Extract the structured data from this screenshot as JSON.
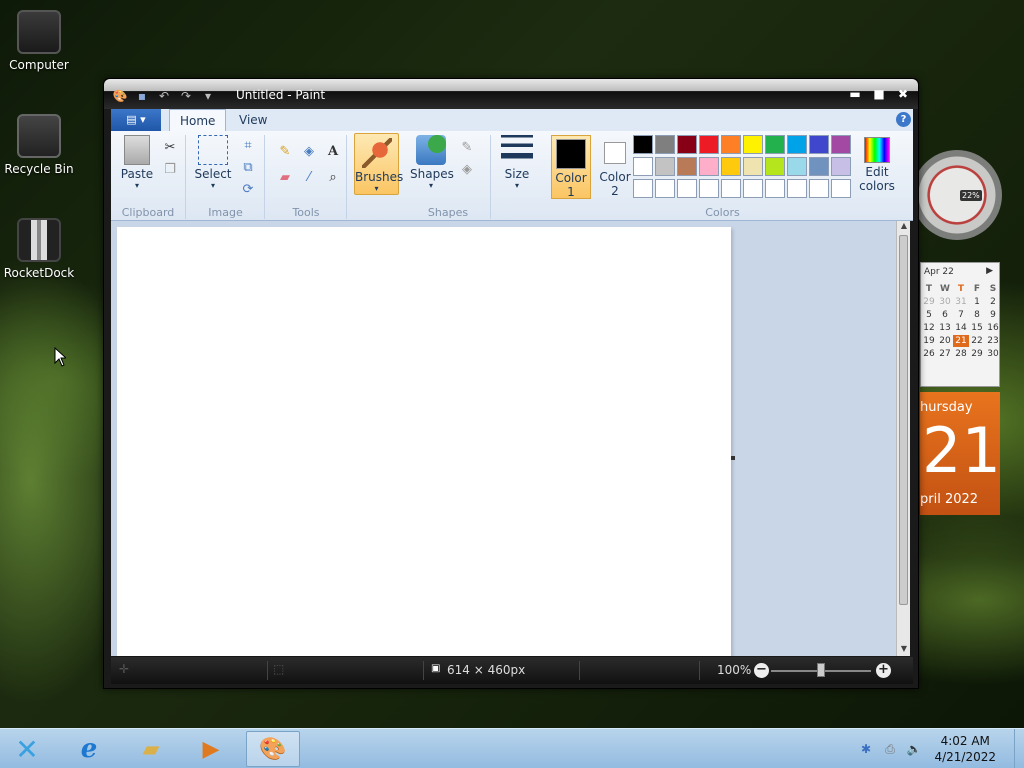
{
  "desktop": {
    "icons": [
      {
        "label": "Computer"
      },
      {
        "label": "Recycle Bin"
      },
      {
        "label": "RocketDock"
      }
    ]
  },
  "window": {
    "title": "Untitled - Paint",
    "quick_access": [
      "save-icon",
      "undo-icon",
      "redo-icon",
      "customize-icon"
    ],
    "controls": {
      "minimize": "▬",
      "maximize": "■",
      "close": "✖"
    }
  },
  "ribbon": {
    "file_menu": "▤ ▾",
    "tabs": [
      {
        "label": "Home",
        "active": true
      },
      {
        "label": "View",
        "active": false
      }
    ],
    "help": "?",
    "groups": {
      "clipboard": {
        "label": "Clipboard",
        "paste": "Paste"
      },
      "image": {
        "label": "Image",
        "select": "Select"
      },
      "tools": {
        "label": "Tools"
      },
      "brushes": {
        "label": "Brushes"
      },
      "shapes": {
        "label": "Shapes",
        "shapes": "Shapes"
      },
      "size": {
        "label": "Size"
      },
      "colors": {
        "label": "Colors",
        "color1": "Color\n1",
        "color1_a": "Color",
        "color1_b": "1",
        "color2_a": "Color",
        "color2_b": "2",
        "edit_a": "Edit",
        "edit_b": "colors",
        "palette_row1": [
          "#000000",
          "#7f7f7f",
          "#880015",
          "#ed1c24",
          "#ff7f27",
          "#fff200",
          "#22b14c",
          "#00a2e8",
          "#3f48cc",
          "#a349a4"
        ],
        "palette_row2": [
          "#ffffff",
          "#c3c3c3",
          "#b97a57",
          "#ffaec9",
          "#ffc90e",
          "#efe4b0",
          "#b5e61d",
          "#99d9ea",
          "#7092be",
          "#c8bfe7"
        ],
        "palette_row3": [
          "#ffffff",
          "#ffffff",
          "#ffffff",
          "#ffffff",
          "#ffffff",
          "#ffffff",
          "#ffffff",
          "#ffffff",
          "#ffffff",
          "#ffffff"
        ],
        "color1_value": "#000000",
        "color2_value": "#ffffff"
      }
    }
  },
  "status": {
    "dimensions": "614 × 460px",
    "zoom": "100%"
  },
  "gadgets": {
    "gauge_label": "22%",
    "calendar": {
      "month": "Apr 22",
      "headers": [
        "T",
        "W",
        "T",
        "F",
        "S"
      ],
      "rows": [
        [
          "29",
          "30",
          "31",
          "1",
          "2"
        ],
        [
          "5",
          "6",
          "7",
          "8",
          "9"
        ],
        [
          "12",
          "13",
          "14",
          "15",
          "16"
        ],
        [
          "19",
          "20",
          "21",
          "22",
          "23"
        ],
        [
          "26",
          "27",
          "28",
          "29",
          "30"
        ]
      ]
    },
    "bigdate": {
      "day_name": "hursday",
      "day_number": "21",
      "month_year": "pril 2022"
    }
  },
  "taskbar": {
    "clock_time": "4:02 AM",
    "clock_date": "4/21/2022"
  }
}
